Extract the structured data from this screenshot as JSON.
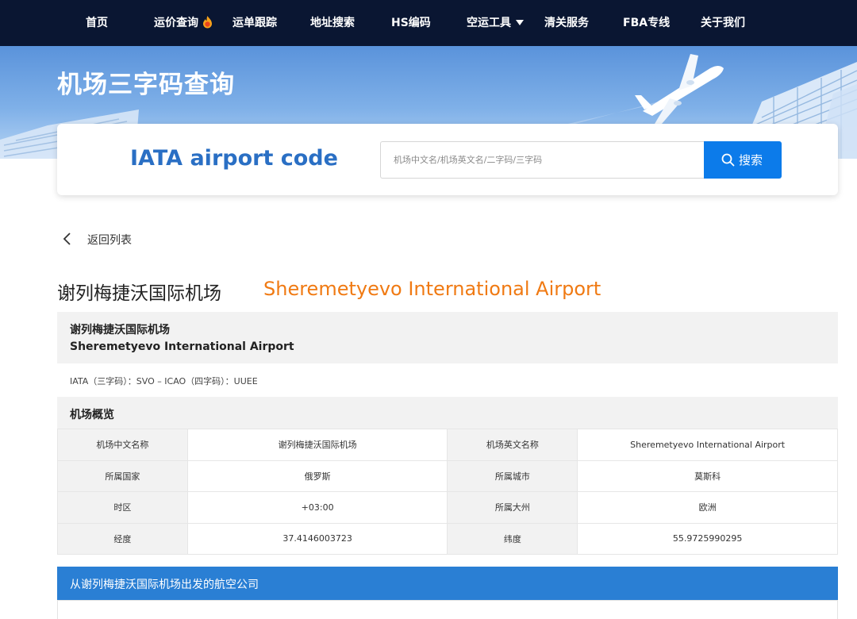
{
  "nav": {
    "items": [
      "首页",
      "运价查询",
      "运单跟踪",
      "地址搜索",
      "HS编码",
      "空运工具",
      "清关服务",
      "FBA专线",
      "关于我们"
    ],
    "hot_icon": "fire-hot-icon",
    "dropdown_icon": "caret-down-icon"
  },
  "banner": {
    "title": "机场三字码查询"
  },
  "search": {
    "title": "IATA airport code",
    "placeholder": "机场中文名/机场英文名/二字码/三字码",
    "value": "",
    "button_label": "搜索",
    "button_icon": "search-icon"
  },
  "back": {
    "label": "返回列表",
    "icon": "chevron-left-icon"
  },
  "airport": {
    "name_cn": "谢列梅捷沃国际机场",
    "name_en": "Sheremetyevo International Airport",
    "codes_line": "IATA（三字码）：SVO – ICAO（四字码）：UUEE"
  },
  "overview": {
    "title": "机场概览",
    "rows": [
      {
        "k1": "机场中文名称",
        "v1": "谢列梅捷沃国际机场",
        "k2": "机场英文名称",
        "v2": "Sheremetyevo International Airport"
      },
      {
        "k1": "所属国家",
        "v1": "俄罗斯",
        "k2": "所属城市",
        "v2": "莫斯科"
      },
      {
        "k1": "时区",
        "v1": "+03:00",
        "k2": "所属大州",
        "v2": "欧洲"
      },
      {
        "k1": "经度",
        "v1": "37.4146003723",
        "k2": "纬度",
        "v2": "55.9725990295"
      }
    ]
  },
  "airlines": {
    "title": "从谢列梅捷沃国际机场出发的航空公司"
  },
  "colors": {
    "nav_bg": "#0a1632",
    "accent_blue": "#0c7bea",
    "section_blue": "#2a7fd4",
    "english_name_orange": "#f07a13",
    "title_blue": "#2a6fc4"
  }
}
